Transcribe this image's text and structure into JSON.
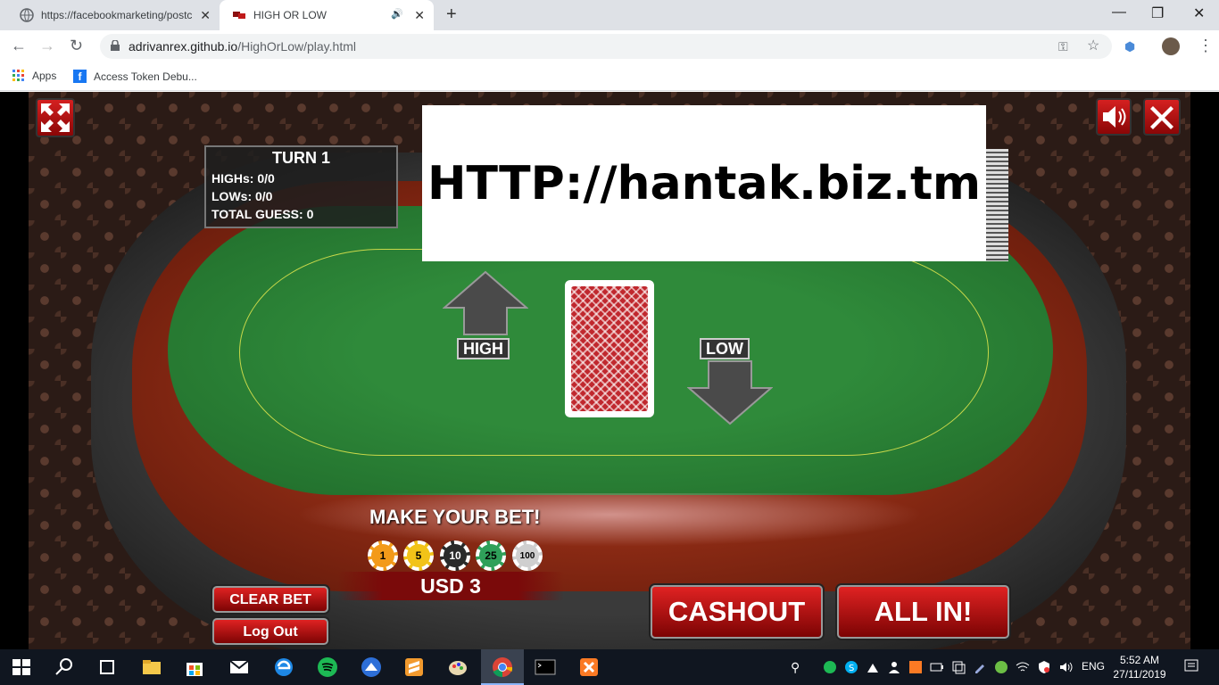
{
  "browser": {
    "tabs": [
      {
        "title": "https://facebookmarketing/postc",
        "active": false
      },
      {
        "title": "HIGH OR LOW",
        "active": true
      }
    ],
    "url_host": "adrivanrex.github.io",
    "url_path": "/HighOrLow/play.html",
    "bookmarks": [
      {
        "label": "Apps"
      },
      {
        "label": "Access Token Debu..."
      }
    ]
  },
  "game": {
    "stats": {
      "turn": "TURN 1",
      "highs": "HIGHs: 0/0",
      "lows": "LOWs: 0/0",
      "total": "TOTAL GUESS: 0"
    },
    "watermark": "HTTP://hantak.biz.tm",
    "high_label": "HIGH",
    "low_label": "LOW",
    "make_bet": "MAKE YOUR BET!",
    "chips": [
      {
        "label": "1",
        "color": "#f39a1a"
      },
      {
        "label": "5",
        "color": "#f2c318"
      },
      {
        "label": "10",
        "color": "#2a2a2a"
      },
      {
        "label": "25",
        "color": "#2fa05a"
      },
      {
        "label": "100",
        "color": "#cfcfcf"
      }
    ],
    "bet_amount": "USD 3",
    "clear_bet": "CLEAR BET",
    "logout": "Log Out",
    "cashout": "CASHOUT",
    "allin": "ALL IN!"
  },
  "taskbar": {
    "lang": "ENG",
    "time": "5:52 AM",
    "date": "27/11/2019"
  },
  "colors": {
    "button_red": "#c41212",
    "felt_green": "#2f8a3a",
    "taskbar": "#101620"
  }
}
